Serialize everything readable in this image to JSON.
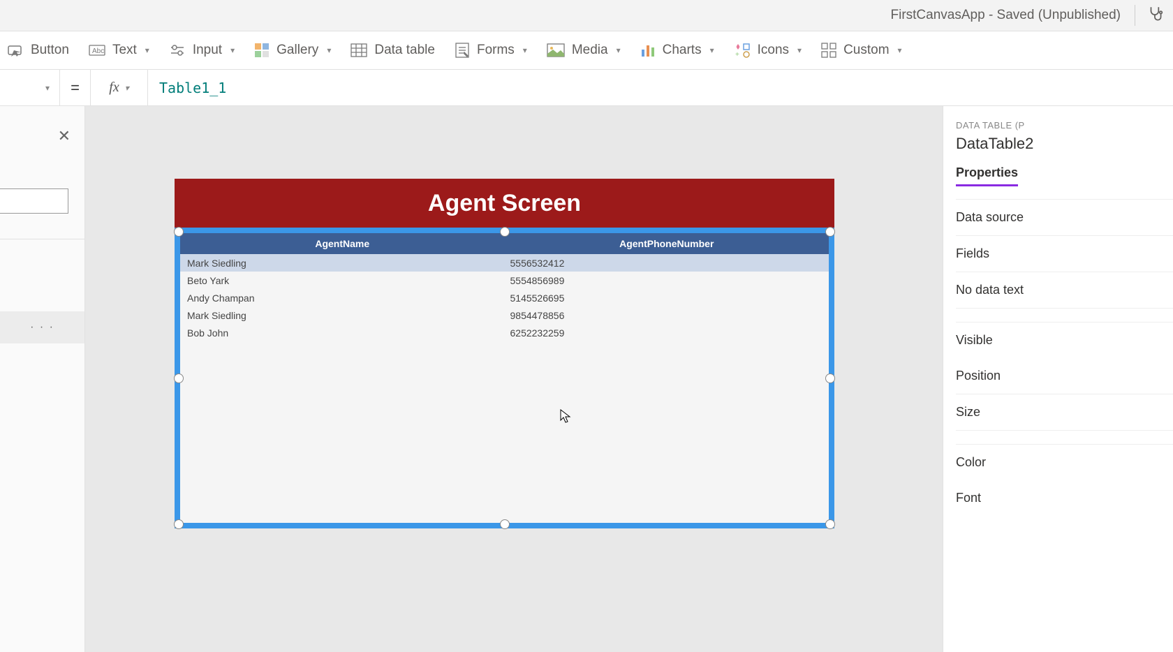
{
  "titlebar": {
    "status": "FirstCanvasApp - Saved (Unpublished)"
  },
  "ribbon": {
    "button": "Button",
    "text": "Text",
    "input": "Input",
    "gallery": "Gallery",
    "datatable": "Data table",
    "forms": "Forms",
    "media": "Media",
    "charts": "Charts",
    "icons": "Icons",
    "custom": "Custom"
  },
  "formula": {
    "equals": "=",
    "fx": "fx",
    "value": "Table1_1"
  },
  "leftpanel": {
    "ellipsis": "· · ·"
  },
  "screen": {
    "title": "Agent Screen",
    "table": {
      "headers": {
        "name": "AgentName",
        "phone": "AgentPhoneNumber"
      },
      "rows": [
        {
          "name": "Mark Siedling",
          "phone": "5556532412"
        },
        {
          "name": "Beto Yark",
          "phone": "5554856989"
        },
        {
          "name": "Andy Champan",
          "phone": "5145526695"
        },
        {
          "name": "Mark Siedling",
          "phone": "9854478856"
        },
        {
          "name": "Bob John",
          "phone": "6252232259"
        }
      ]
    }
  },
  "rightpanel": {
    "caption": "DATA TABLE (P",
    "title": "DataTable2",
    "tab": "Properties",
    "rows": {
      "datasource": "Data source",
      "fields": "Fields",
      "nodata": "No data text",
      "visible": "Visible",
      "position": "Position",
      "size": "Size",
      "color": "Color",
      "font": "Font"
    }
  }
}
